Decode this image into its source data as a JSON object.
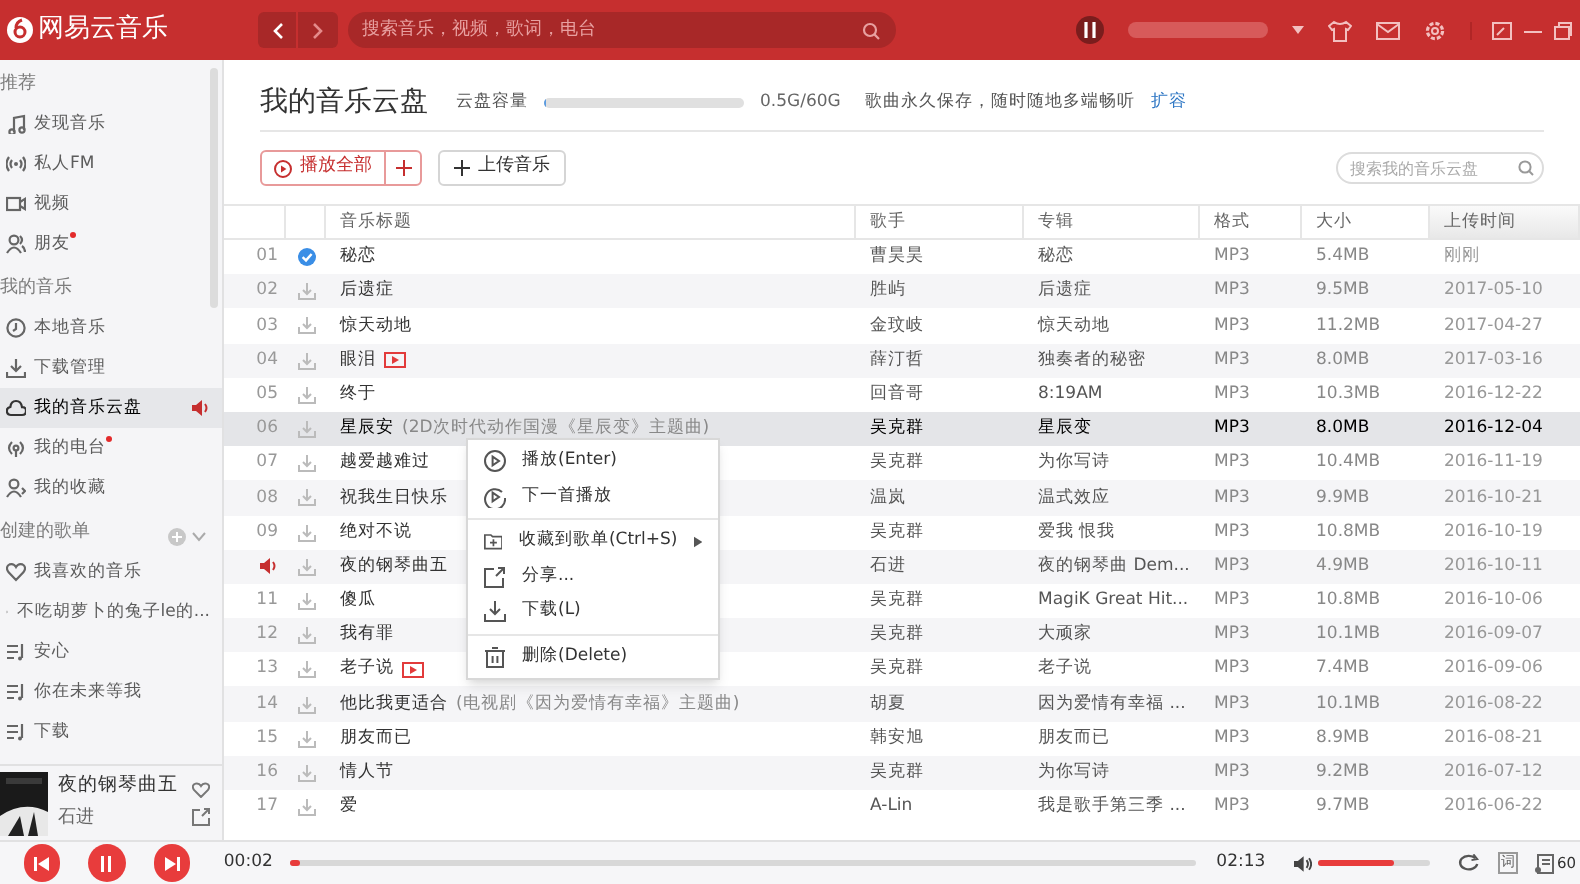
{
  "header": {
    "logo": "网易云音乐",
    "search_placeholder": "搜索音乐，视频，歌词，电台"
  },
  "sidebar": {
    "sections": [
      {
        "title": "推荐",
        "add": false,
        "items": [
          {
            "label": "发现音乐",
            "selected": false,
            "notification": false,
            "playing": false
          },
          {
            "label": "私人FM",
            "selected": false,
            "notification": false,
            "playing": false
          },
          {
            "label": "视频",
            "selected": false,
            "notification": false,
            "playing": false
          },
          {
            "label": "朋友",
            "selected": false,
            "notification": true,
            "playing": false
          }
        ]
      },
      {
        "title": "我的音乐",
        "add": false,
        "items": [
          {
            "label": "本地音乐",
            "selected": false,
            "notification": false,
            "playing": false
          },
          {
            "label": "下载管理",
            "selected": false,
            "notification": false,
            "playing": false
          },
          {
            "label": "我的音乐云盘",
            "selected": true,
            "notification": false,
            "playing": true
          },
          {
            "label": "我的电台",
            "selected": false,
            "notification": true,
            "playing": false
          },
          {
            "label": "我的收藏",
            "selected": false,
            "notification": false,
            "playing": false
          }
        ]
      },
      {
        "title": "创建的歌单",
        "add": true,
        "items": [
          {
            "label": "我喜欢的音乐",
            "selected": false,
            "notification": false,
            "playing": false
          },
          {
            "label": "不吃胡萝卜的兔子le的...",
            "selected": false,
            "notification": false,
            "playing": false
          },
          {
            "label": "安心",
            "selected": false,
            "notification": false,
            "playing": false
          },
          {
            "label": "你在未来等我",
            "selected": false,
            "notification": false,
            "playing": false
          },
          {
            "label": "下载",
            "selected": false,
            "notification": false,
            "playing": false
          }
        ]
      }
    ],
    "now_playing": {
      "title": "夜的钢琴曲五",
      "artist": "石进"
    }
  },
  "cloud": {
    "title": "我的音乐云盘",
    "capacity_label": "云盘容量",
    "capacity": {
      "level": 0.01
    },
    "capacity_text": "0.5G/60G",
    "note": "歌曲永久保存，随时随地多端畅听",
    "expand_link": "扩容"
  },
  "toolbar": {
    "play_all": "播放全部",
    "upload": "上传音乐",
    "search_placeholder": "搜索我的音乐云盘"
  },
  "table": {
    "columns": [
      {
        "label": "音乐标题",
        "sorted": false
      },
      {
        "label": "歌手",
        "sorted": false
      },
      {
        "label": "专辑",
        "sorted": false
      },
      {
        "label": "格式",
        "sorted": false
      },
      {
        "label": "大小",
        "sorted": false
      },
      {
        "label": "上传时间",
        "sorted": true
      }
    ],
    "rows": [
      {
        "index": "01",
        "title": "秘恋",
        "mv": false,
        "downloaded": true,
        "playing": false,
        "selected": false,
        "singer": "曹昊昊",
        "album": "秘恋",
        "format": "MP3",
        "size": "5.4MB",
        "uploaded": "刚刚"
      },
      {
        "index": "02",
        "title": "后遗症",
        "mv": false,
        "downloaded": false,
        "playing": false,
        "selected": false,
        "singer": "胜屿",
        "album": "后遗症",
        "format": "MP3",
        "size": "9.5MB",
        "uploaded": "2017-05-10"
      },
      {
        "index": "03",
        "title": "惊天动地",
        "mv": false,
        "downloaded": false,
        "playing": false,
        "selected": false,
        "singer": "金玟岐",
        "album": "惊天动地",
        "format": "MP3",
        "size": "11.2MB",
        "uploaded": "2017-04-27"
      },
      {
        "index": "04",
        "title": "眼泪",
        "mv": true,
        "downloaded": false,
        "playing": false,
        "selected": false,
        "singer": "薛汀哲",
        "album": "独奏者的秘密",
        "format": "MP3",
        "size": "8.0MB",
        "uploaded": "2017-03-16"
      },
      {
        "index": "05",
        "title": "终于",
        "mv": false,
        "downloaded": false,
        "playing": false,
        "selected": false,
        "singer": "回音哥",
        "album": "8:19AM",
        "format": "MP3",
        "size": "10.3MB",
        "uploaded": "2016-12-22"
      },
      {
        "index": "06",
        "title": "星辰安",
        "subtitle": "(2D次时代动作国漫《星辰变》主题曲)",
        "mv": false,
        "downloaded": false,
        "playing": false,
        "selected": true,
        "singer": "吴克群",
        "album": "星辰变",
        "format": "MP3",
        "size": "8.0MB",
        "uploaded": "2016-12-04"
      },
      {
        "index": "07",
        "title": "越爱越难过",
        "mv": false,
        "downloaded": false,
        "playing": false,
        "selected": false,
        "singer": "吴克群",
        "album": "为你写诗",
        "format": "MP3",
        "size": "10.4MB",
        "uploaded": "2016-11-19"
      },
      {
        "index": "08",
        "title": "祝我生日快乐",
        "mv": false,
        "downloaded": false,
        "playing": false,
        "selected": false,
        "singer": "温岚",
        "album": "温式效应",
        "format": "MP3",
        "size": "9.9MB",
        "uploaded": "2016-10-21"
      },
      {
        "index": "09",
        "title": "绝对不说",
        "mv": false,
        "downloaded": false,
        "playing": false,
        "selected": false,
        "singer": "吴克群",
        "album": "爱我 恨我",
        "format": "MP3",
        "size": "10.8MB",
        "uploaded": "2016-10-19"
      },
      {
        "title": "夜的钢琴曲五",
        "mv": false,
        "downloaded": false,
        "playing": true,
        "selected": false,
        "singer": "石进",
        "album": "夜的钢琴曲 Dem...",
        "format": "MP3",
        "size": "4.9MB",
        "uploaded": "2016-10-11"
      },
      {
        "index": "11",
        "title": "傻瓜",
        "mv": false,
        "downloaded": false,
        "playing": false,
        "selected": false,
        "singer": "吴克群",
        "album": "MagiK Great Hit...",
        "format": "MP3",
        "size": "10.8MB",
        "uploaded": "2016-10-06"
      },
      {
        "index": "12",
        "title": "我有罪",
        "mv": false,
        "downloaded": false,
        "playing": false,
        "selected": false,
        "singer": "吴克群",
        "album": "大顽家",
        "format": "MP3",
        "size": "10.1MB",
        "uploaded": "2016-09-07"
      },
      {
        "index": "13",
        "title": "老子说",
        "mv": true,
        "downloaded": false,
        "playing": false,
        "selected": false,
        "singer": "吴克群",
        "album": "老子说",
        "format": "MP3",
        "size": "7.4MB",
        "uploaded": "2016-09-06"
      },
      {
        "index": "14",
        "title": "他比我更适合",
        "subtitle": "(电视剧《因为爱情有幸福》主题曲)",
        "mv": false,
        "downloaded": false,
        "playing": false,
        "selected": false,
        "singer": "胡夏",
        "album": "因为爱情有幸福 ...",
        "format": "MP3",
        "size": "10.1MB",
        "uploaded": "2016-08-22"
      },
      {
        "index": "15",
        "title": "朋友而已",
        "mv": false,
        "downloaded": false,
        "playing": false,
        "selected": false,
        "singer": "韩安旭",
        "album": "朋友而已",
        "format": "MP3",
        "size": "8.9MB",
        "uploaded": "2016-08-21"
      },
      {
        "index": "16",
        "title": "情人节",
        "mv": false,
        "downloaded": false,
        "playing": false,
        "selected": false,
        "singer": "吴克群",
        "album": "为你写诗",
        "format": "MP3",
        "size": "9.2MB",
        "uploaded": "2016-07-12"
      },
      {
        "index": "17",
        "title": "爱",
        "mv": false,
        "downloaded": false,
        "playing": false,
        "selected": false,
        "singer": "A-Lin",
        "album": "我是歌手第三季 ...",
        "format": "MP3",
        "size": "9.7MB",
        "uploaded": "2016-06-22"
      }
    ]
  },
  "context_menu": [
    {
      "label": "播放(Enter)",
      "submenu": false,
      "divider_after": false
    },
    {
      "label": "下一首播放",
      "submenu": false,
      "divider_after": true
    },
    {
      "label": "收藏到歌单(Ctrl+S)",
      "submenu": true,
      "divider_after": false
    },
    {
      "label": "分享...",
      "submenu": false,
      "divider_after": false
    },
    {
      "label": "下载(L)",
      "submenu": false,
      "divider_after": true
    },
    {
      "label": "删除(Delete)",
      "submenu": false,
      "divider_after": false
    }
  ],
  "player": {
    "elapsed": "00:02",
    "progress": {
      "level": 0.01
    },
    "duration": "02:13",
    "volume": {
      "level": 0.68
    },
    "lyrics_button": "词",
    "playlist_count": "60"
  }
}
